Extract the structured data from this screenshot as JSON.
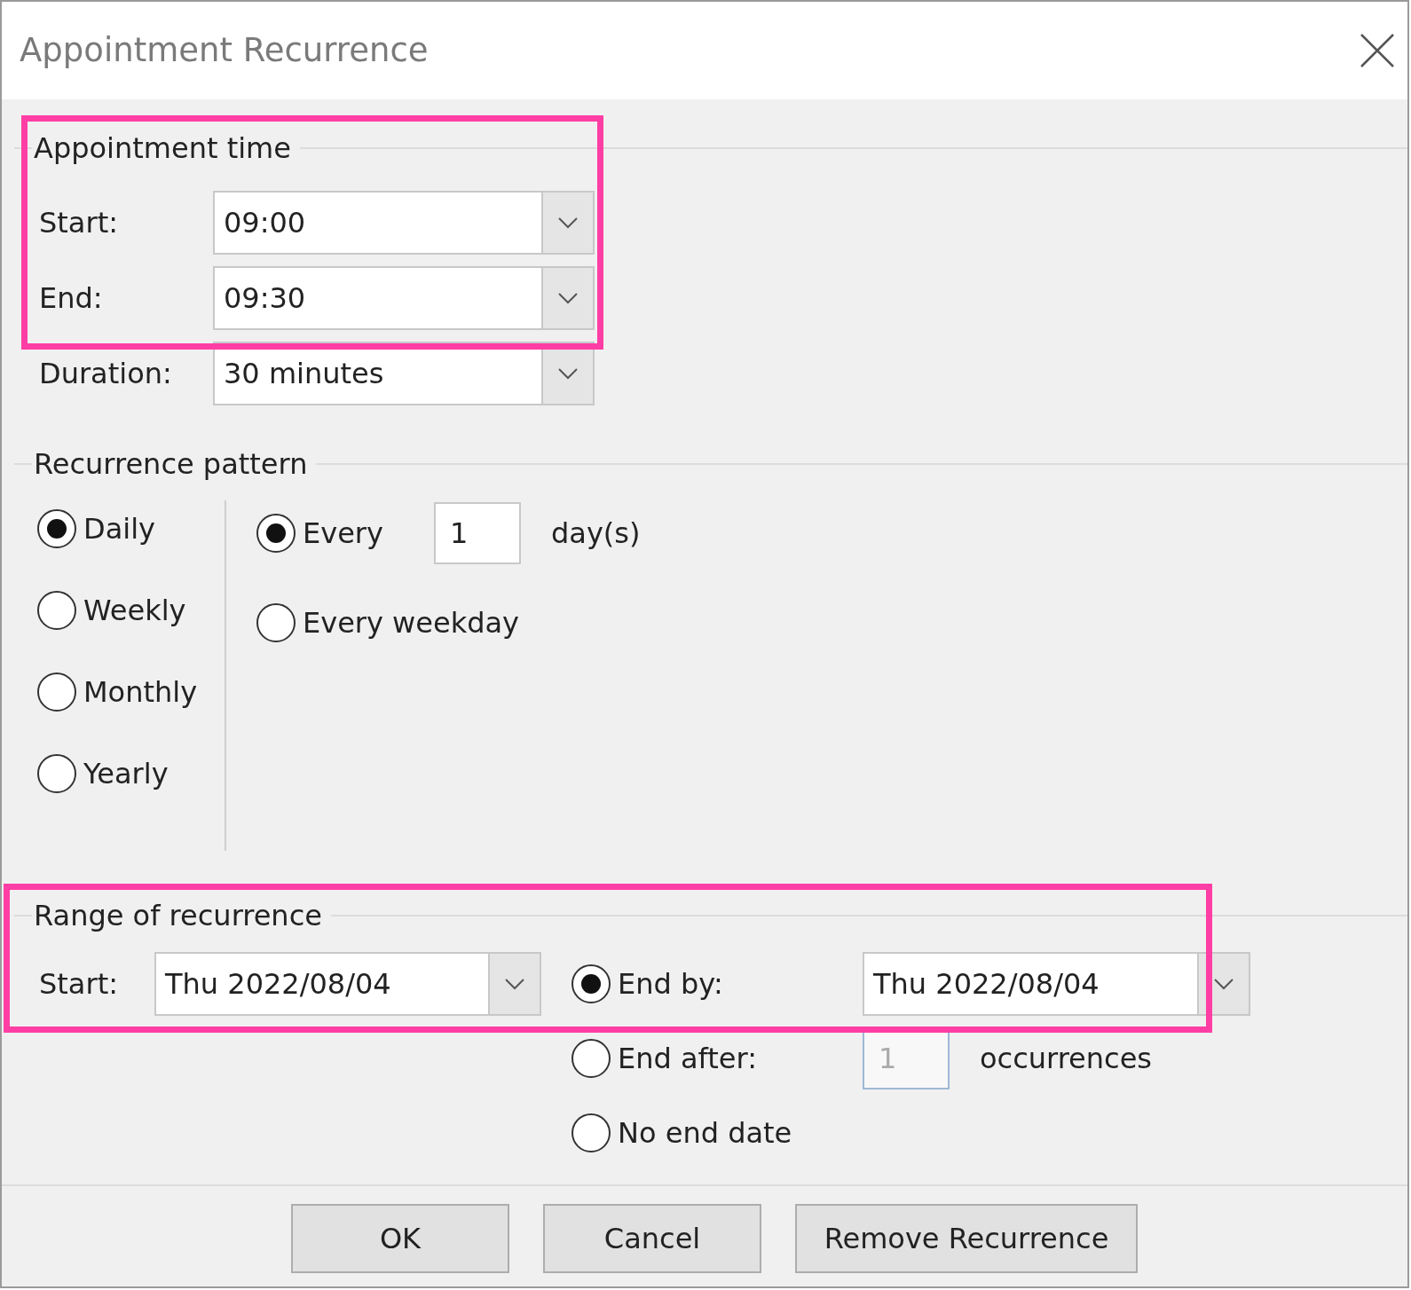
{
  "window": {
    "title": "Appointment Recurrence"
  },
  "appointment_time": {
    "title": "Appointment time",
    "fields": [
      {
        "label": "Start:",
        "value": "09:00"
      },
      {
        "label": "End:",
        "value": "09:30"
      },
      {
        "label": "Duration:",
        "value": "30 minutes"
      }
    ]
  },
  "recurrence_pattern": {
    "title": "Recurrence pattern",
    "frequencies": [
      {
        "label": "Daily",
        "selected": true
      },
      {
        "label": "Weekly",
        "selected": false
      },
      {
        "label": "Monthly",
        "selected": false
      },
      {
        "label": "Yearly",
        "selected": false
      }
    ],
    "options": [
      {
        "kind": "every",
        "label": "Every",
        "selected": true,
        "value": "1",
        "unit": "day(s)"
      },
      {
        "kind": "plain",
        "label": "Every weekday",
        "selected": false
      }
    ]
  },
  "range": {
    "title": "Range of recurrence",
    "start": {
      "label": "Start:",
      "value": "Thu 2022/08/04"
    },
    "options": [
      {
        "kind": "date",
        "label": "End by:",
        "selected": true,
        "value": "Thu 2022/08/04"
      },
      {
        "kind": "count",
        "label": "End after:",
        "selected": false,
        "value": "1",
        "unit": "occurrences",
        "disabled": true
      },
      {
        "kind": "plain",
        "label": "No end date",
        "selected": false
      }
    ]
  },
  "buttons": [
    {
      "label": "OK"
    },
    {
      "label": "Cancel"
    },
    {
      "label": "Remove Recurrence"
    }
  ]
}
